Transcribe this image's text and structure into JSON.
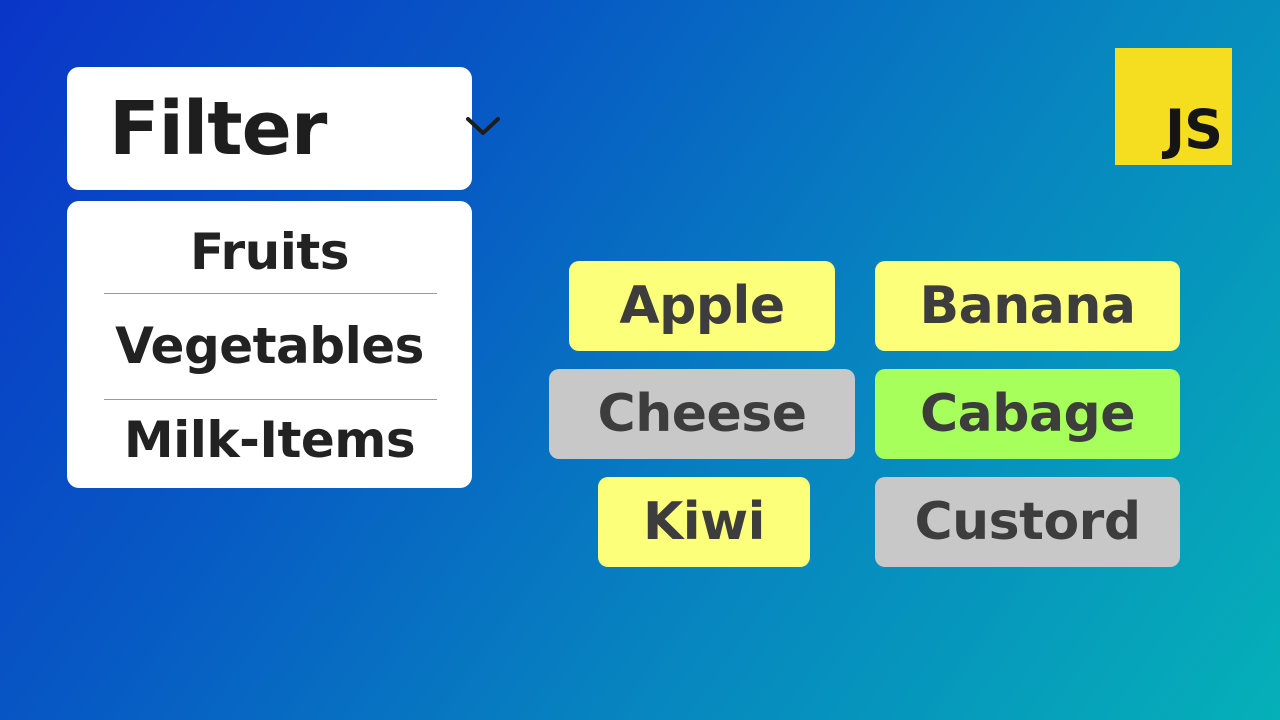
{
  "filter": {
    "label": "Filter",
    "options": [
      "Fruits",
      "Vegetables",
      "Milk-Items"
    ]
  },
  "logo": {
    "text": "JS",
    "color": "#f5dd1f"
  },
  "items": [
    {
      "label": "Apple",
      "category": "fruit",
      "color": "#fbff7a"
    },
    {
      "label": "Banana",
      "category": "fruit",
      "color": "#fbff7a"
    },
    {
      "label": "Cheese",
      "category": "milk",
      "color": "#c8c8c8"
    },
    {
      "label": "Cabage",
      "category": "vegetable",
      "color": "#a6ff5a"
    },
    {
      "label": "Kiwi",
      "category": "fruit",
      "color": "#fbff7a"
    },
    {
      "label": "Custord",
      "category": "milk",
      "color": "#c8c8c8"
    }
  ],
  "icons": {
    "dropdown": "chevron-down-icon"
  }
}
